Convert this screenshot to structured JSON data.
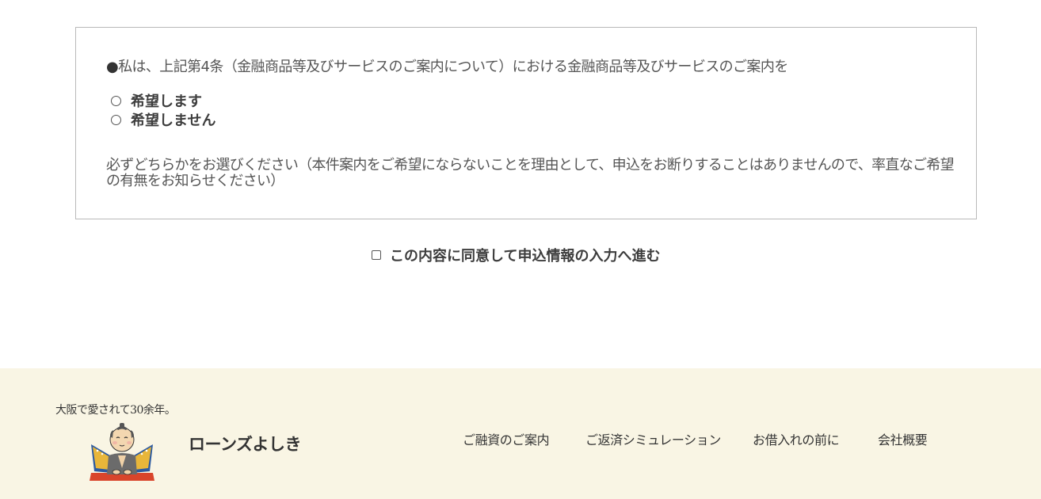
{
  "consent": {
    "bullet": "●",
    "question": "私は、上記第4条（金融商品等及びサービスのご案内について）における金融商品等及びサービスのご案内を",
    "options": [
      {
        "label": "希望します",
        "selected": false
      },
      {
        "label": "希望しません",
        "selected": false
      }
    ],
    "note": "必ずどちらかをお選びください（本件案内をご希望にならないことを理由として、申込をお断りすることはありませんので、率直なご希望の有無をお知らせください）"
  },
  "agree": {
    "label": "この内容に同意して申込情報の入力へ進む",
    "checked": false
  },
  "footer": {
    "tagline": "大阪で愛されて30余年。",
    "brand": "ローンズよしき",
    "mascot_icon": "samurai-mascot-icon",
    "nav": [
      {
        "label": "ご融資のご案内"
      },
      {
        "label": "ご返済シミュレーション"
      },
      {
        "label": "お借入れの前に"
      },
      {
        "label": "会社概要"
      }
    ],
    "background": "#f9f5e4"
  }
}
